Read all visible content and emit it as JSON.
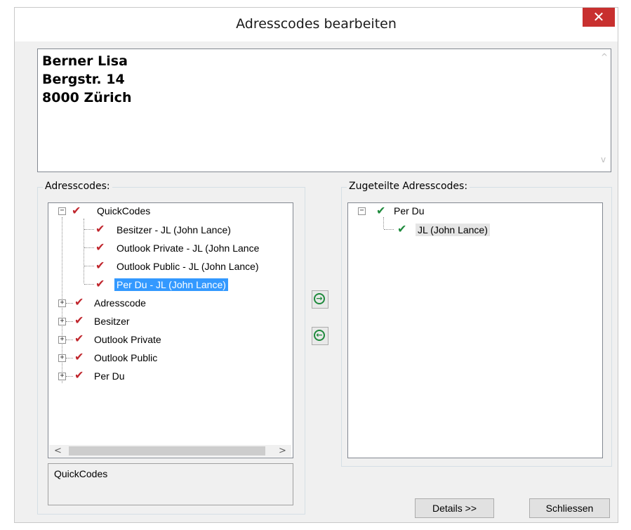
{
  "window": {
    "title": "Adresscodes bearbeiten",
    "close_glyph": "✕"
  },
  "address": {
    "lines": [
      "Berner Lisa",
      "Bergstr. 14",
      "8000 Zürich"
    ]
  },
  "left_group": {
    "legend": "Adresscodes:",
    "tree": [
      {
        "label": "QuickCodes",
        "expanded": true,
        "children": [
          {
            "label": "Besitzer - JL (John Lance)"
          },
          {
            "label": "Outlook Private - JL (John Lance"
          },
          {
            "label": "Outlook Public - JL (John Lance)"
          },
          {
            "label": "Per Du - JL (John Lance)",
            "selected": true
          }
        ]
      },
      {
        "label": "Adresscode",
        "expanded": false
      },
      {
        "label": "Besitzer",
        "expanded": false
      },
      {
        "label": "Outlook Private",
        "expanded": false
      },
      {
        "label": "Outlook Public",
        "expanded": false
      },
      {
        "label": "Per Du",
        "expanded": false
      }
    ],
    "status_text": "QuickCodes"
  },
  "right_group": {
    "legend": "Zugeteilte Adresscodes:",
    "tree": [
      {
        "label": "Per Du",
        "expanded": true,
        "children": [
          {
            "label": "JL (John Lance)",
            "highlight": true
          }
        ]
      }
    ]
  },
  "buttons": {
    "assign_glyph": "→",
    "unassign_glyph": "←",
    "details": "Details >>",
    "close": "Schliessen"
  },
  "icons": {
    "check": "✔",
    "expand": "+",
    "collapse": "−",
    "scroll_left": "<",
    "scroll_right": ">",
    "scroll_up": "^",
    "scroll_down": "v"
  },
  "colors": {
    "selection": "#3399ff",
    "close_red": "#c8302f",
    "check_red": "#c0262d",
    "check_green": "#1e8a3c"
  }
}
